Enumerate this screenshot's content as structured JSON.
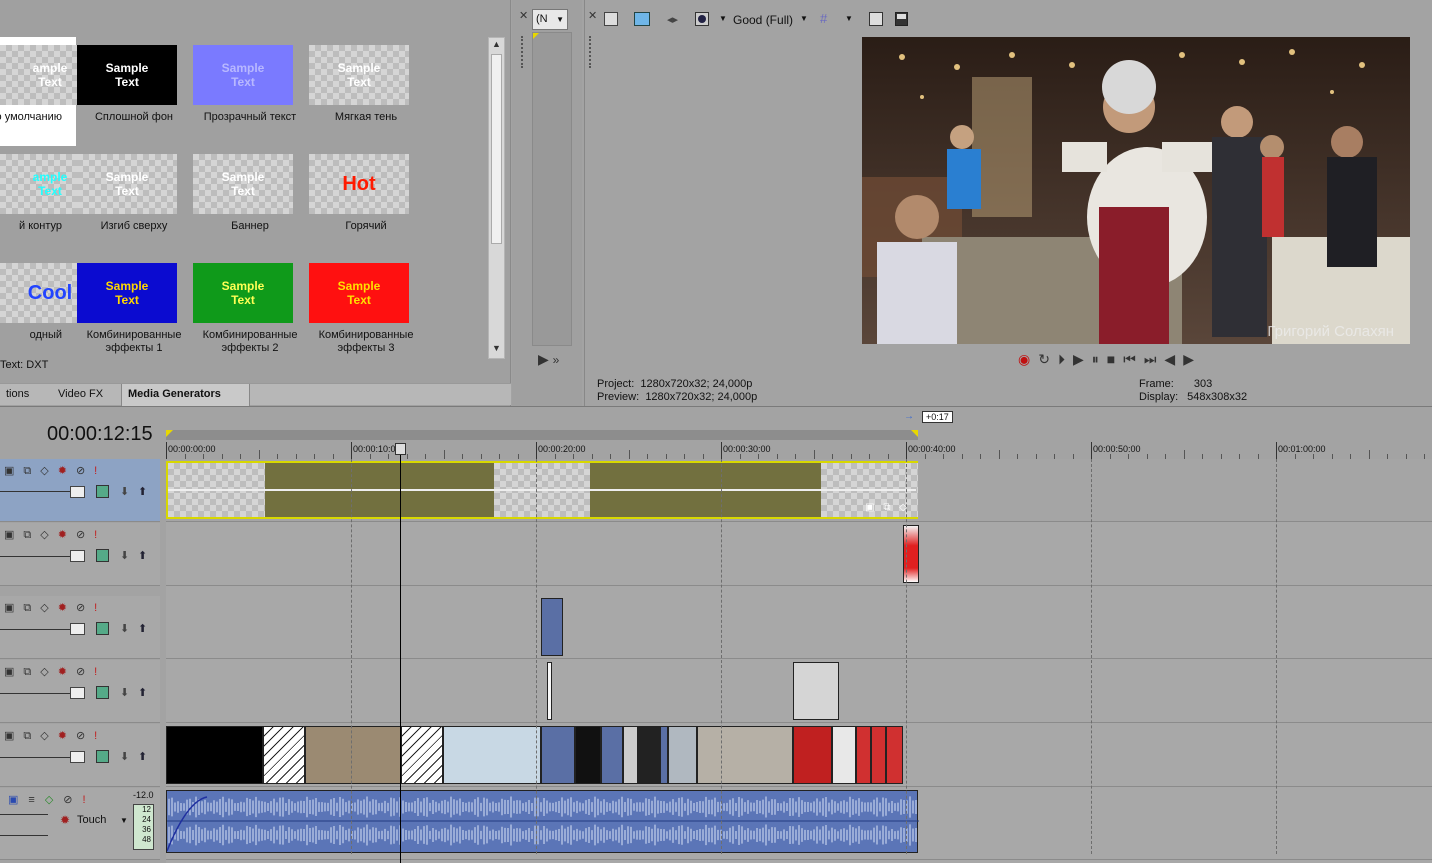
{
  "generators": {
    "presets": [
      {
        "name": "preset-default",
        "label": "о умолчанию",
        "thumb": "ample\nText",
        "bg": "checker",
        "color": "#ffffff"
      },
      {
        "name": "preset-solid-bg",
        "label": "Сплошной фон",
        "thumb": "Sample\nText",
        "bg": "#000000",
        "color": "#ffffff"
      },
      {
        "name": "preset-transparent",
        "label": "Прозрачный текст",
        "thumb": "Sample\nText",
        "bg": "#7a7aff",
        "color": "#b8b8ff"
      },
      {
        "name": "preset-soft-shadow",
        "label": "Мягкая тень",
        "thumb": "Sample\nText",
        "bg": "checker",
        "color": "#ffffff"
      },
      {
        "name": "preset-outline",
        "label": "й контур",
        "thumb": "ample\nText",
        "bg": "checker",
        "color": "#22ffff"
      },
      {
        "name": "preset-arch",
        "label": "Изгиб сверху",
        "thumb": "Sample\nText",
        "bg": "checker",
        "color": "#ffffff"
      },
      {
        "name": "preset-banner",
        "label": "Баннер",
        "thumb": "Sample\nText",
        "bg": "checker",
        "color": "#ffffff"
      },
      {
        "name": "preset-hot",
        "label": "Горячий",
        "thumb": "Hot",
        "bg": "checker",
        "color": "#ff1a00"
      },
      {
        "name": "preset-cool",
        "label": "одный",
        "thumb": "Cool",
        "bg": "checker",
        "color": "#2244ff"
      },
      {
        "name": "preset-combo-1",
        "label": "Комбинированные эффекты 1",
        "thumb": "Sample\nText",
        "bg": "#0b0bd0",
        "color": "#ffd800"
      },
      {
        "name": "preset-combo-2",
        "label": "Комбинированные эффекты 2",
        "thumb": "Sample\nText",
        "bg": "#0f9a1a",
        "color": "#ffff55"
      },
      {
        "name": "preset-combo-3",
        "label": "Комбинированные эффекты 3",
        "thumb": "Sample\nText",
        "bg": "#ff1010",
        "color": "#ffe000"
      }
    ],
    "status": "Text: DXT"
  },
  "tabs": [
    {
      "label": "tions",
      "active": false
    },
    {
      "label": "Video FX",
      "active": false
    },
    {
      "label": "Media Generators",
      "active": true
    }
  ],
  "trimmer": {
    "select_value": "(N"
  },
  "preview": {
    "quality": "Good (Full)",
    "watermark": "Григорий Солахян",
    "project_label": "Project:",
    "project_value": "1280x720x32; 24,000p",
    "preview_label": "Preview:",
    "preview_value": "1280x720x32; 24,000p",
    "frame_label": "Frame:",
    "frame_value": "303",
    "display_label": "Display:",
    "display_value": "548x308x32"
  },
  "timeline": {
    "timecode": "00:00:12:15",
    "region_badge": "+0:17",
    "ticks": [
      "00:00:00:00",
      "00:00:10:00",
      "00:00:20:00",
      "00:00:30:00",
      "00:00:40:00",
      "00:00:50:00",
      "00:01:00:00"
    ],
    "audio": {
      "touch_label": "Touch",
      "db": "-12.0",
      "meter": [
        "12",
        "24",
        "36",
        "48"
      ]
    }
  },
  "colors": {
    "accent_selected": "#8da3c4",
    "title_clip": "#72703f",
    "video_clip": "#5a6fa5",
    "audio_clip": "#5b75b7",
    "selection_outline": "#d8d800"
  }
}
